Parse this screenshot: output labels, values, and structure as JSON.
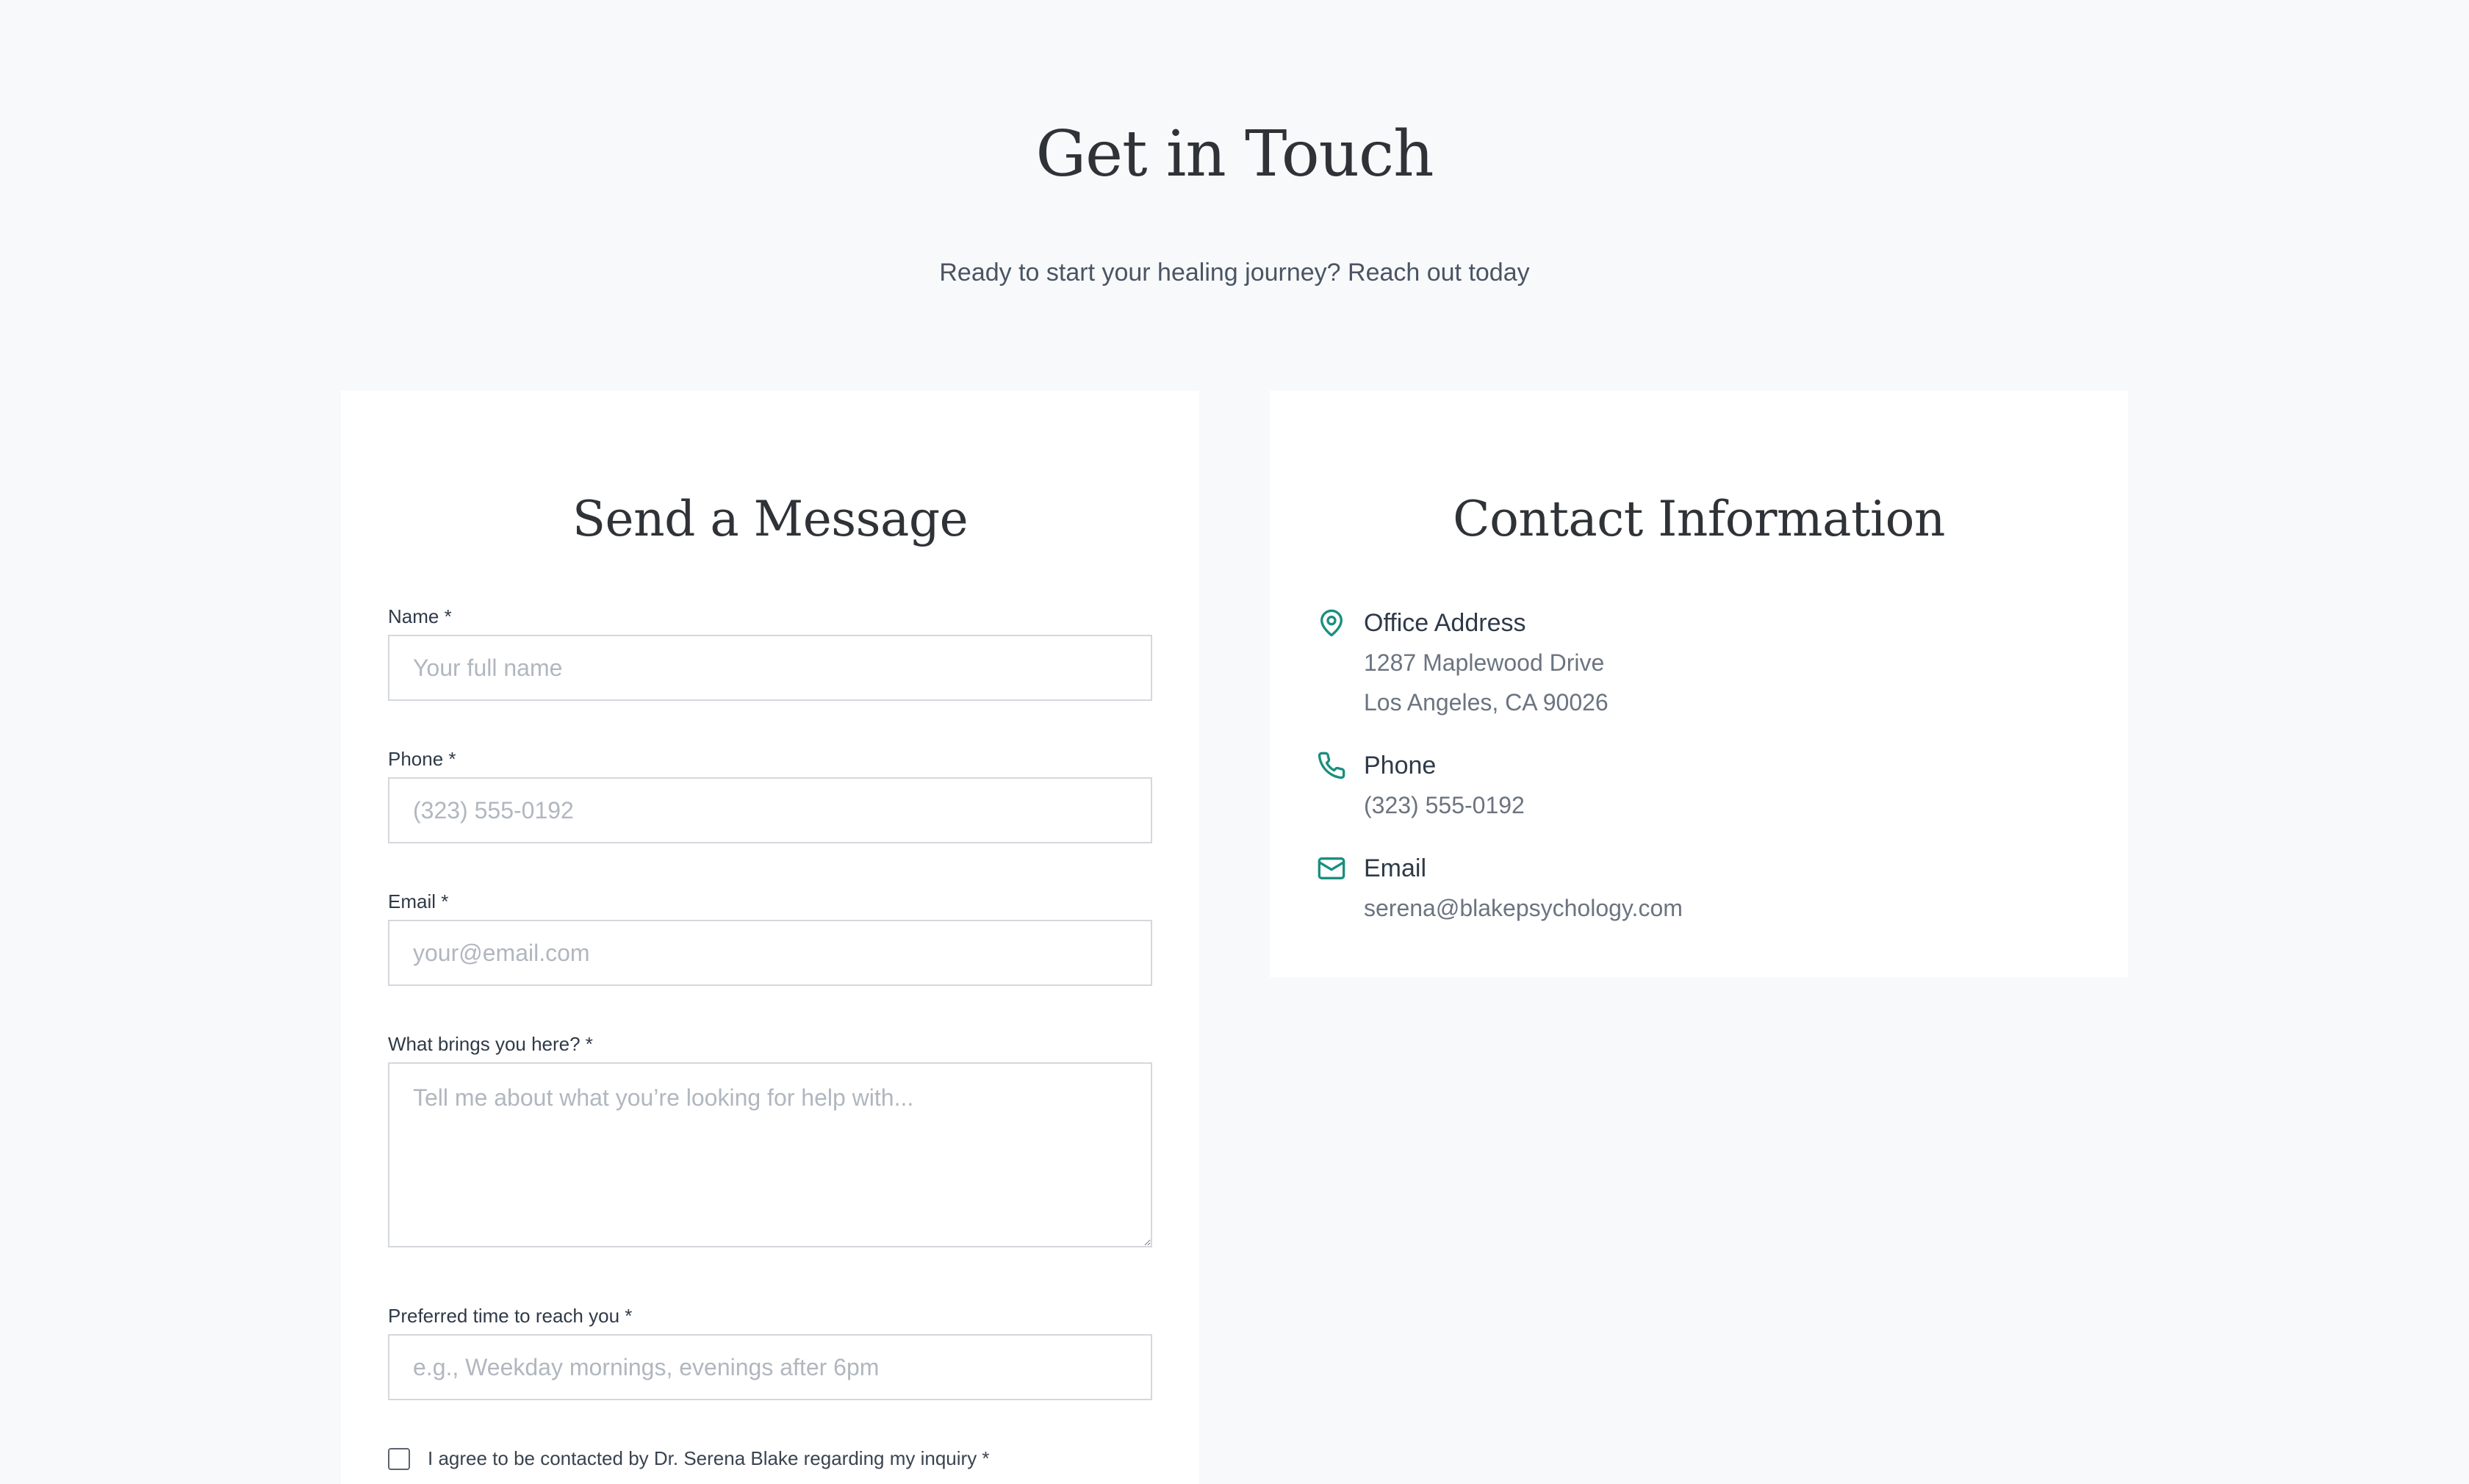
{
  "header": {
    "title": "Get in Touch",
    "subtitle": "Ready to start your healing journey? Reach out today"
  },
  "form": {
    "title": "Send a Message",
    "fields": {
      "name": {
        "label": "Name *",
        "placeholder": "Your full name",
        "value": ""
      },
      "phone": {
        "label": "Phone *",
        "placeholder": "(323) 555-0192",
        "value": ""
      },
      "email": {
        "label": "Email *",
        "placeholder": "your@email.com",
        "value": ""
      },
      "message": {
        "label": "What brings you here? *",
        "placeholder": "Tell me about what you’re looking for help with...",
        "value": ""
      },
      "preferred_time": {
        "label": "Preferred time to reach you *",
        "placeholder": "e.g., Weekday mornings, evenings after 6pm",
        "value": ""
      }
    },
    "consent": {
      "label": "I agree to be contacted by Dr. Serena Blake regarding my inquiry *",
      "checked": false
    }
  },
  "contact": {
    "title": "Contact Information",
    "accent_color": "#1a8f7e",
    "items": [
      {
        "icon": "map-pin-icon",
        "heading": "Office Address",
        "lines": [
          "1287 Maplewood Drive",
          "Los Angeles, CA 90026"
        ]
      },
      {
        "icon": "phone-icon",
        "heading": "Phone",
        "lines": [
          "(323) 555-0192"
        ]
      },
      {
        "icon": "mail-icon",
        "heading": "Email",
        "lines": [
          "serena@blakepsychology.com"
        ]
      }
    ]
  }
}
